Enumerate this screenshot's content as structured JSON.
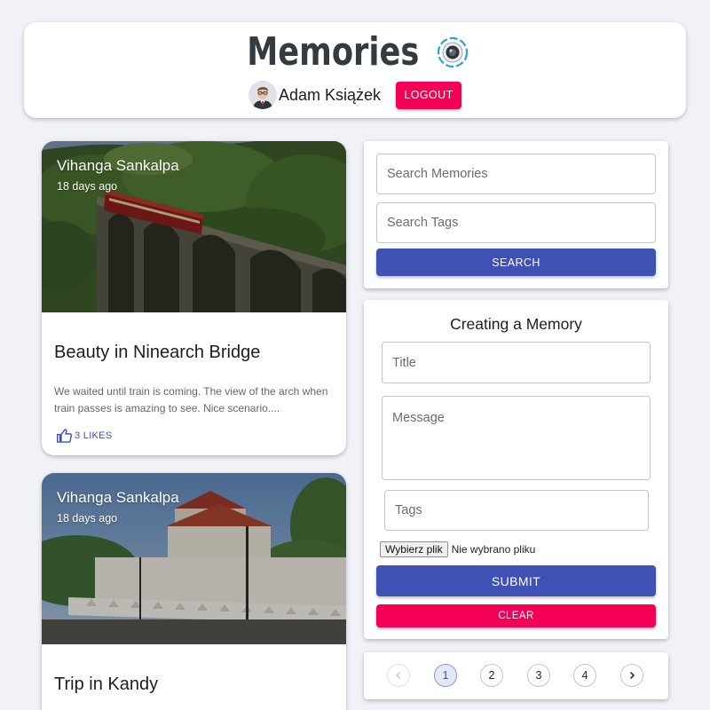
{
  "app": {
    "title": "Memories"
  },
  "user": {
    "name": "Adam Książek",
    "logout_label": "LOGOUT"
  },
  "posts": [
    {
      "author": "Vihanga Sankalpa",
      "time": "18 days ago",
      "title": "Beauty in Ninearch Bridge",
      "message": "We waited until train is coming. The view of the arch when train passes is amazing to see. Nice scenario....",
      "likes": "3 LIKES",
      "image": "train-bridge-photo"
    },
    {
      "author": "Vihanga Sankalpa",
      "time": "18 days ago",
      "title": "Trip in Kandy",
      "image": "kandy-temple-photo"
    }
  ],
  "search": {
    "memories_placeholder": "Search Memories",
    "tags_placeholder": "Search Tags",
    "button_label": "SEARCH"
  },
  "form": {
    "heading": "Creating a Memory",
    "title_placeholder": "Title",
    "message_placeholder": "Message",
    "tags_placeholder": "Tags",
    "file_button": "Wybierz plik",
    "file_status": "Nie wybrano pliku",
    "submit_label": "SUBMIT",
    "clear_label": "CLEAR"
  },
  "pagination": {
    "pages": [
      "1",
      "2",
      "3",
      "4"
    ],
    "current": "1",
    "prev_icon": "chevron-left-icon",
    "next_icon": "chevron-right-icon"
  },
  "colors": {
    "primary": "#3f51b5",
    "secondary": "#f50057",
    "background": "#f0f2f8",
    "brand_text": "#333a40"
  }
}
